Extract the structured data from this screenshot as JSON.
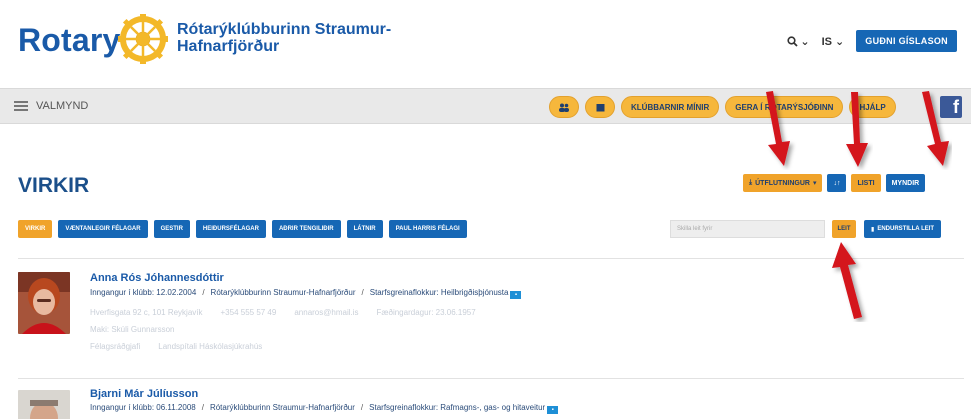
{
  "header": {
    "logo_word": "Rotary",
    "club_name_line1": "Rótarýklúbburinn Straumur-",
    "club_name_line2": "Hafnarfjörður",
    "search_label": "Q",
    "lang_label": "IS",
    "user_button": "GUÐNI GÍSLASON"
  },
  "menubar": {
    "menu_label": "VALMYND",
    "klubbarnir_label": "KLÚBBARNIR MÍNIR",
    "gerast_label": "GERA Í RÓTARÝSJÓÐINN",
    "help_label": "HJÁLP",
    "facebook_glyph": "f"
  },
  "page": {
    "title": "VIRKIR"
  },
  "view_controls": {
    "export_label": "ÚTFLUTNINGUR",
    "list_label": "LISTI",
    "images_label": "MYNDIR"
  },
  "filters": {
    "items": [
      "VIRKIR",
      "VÆNTANLEGIR FÉLAGAR",
      "GESTIR",
      "HEIÐURSFÉLAGAR",
      "AÐRIR TENGILIÐIR",
      "LÁTNIR",
      "PAUL HARRIS FÉLAGI"
    ],
    "search_placeholder": "Skilla leit fyrir",
    "search_button": "LEIT",
    "reset_button": "ENDURSTILLA LEIT"
  },
  "members": [
    {
      "name": "Anna Rós Jóhannesdóttir",
      "info_join": "Inngangur í klúbb: 12.02.2004",
      "info_club": "Rótarýklúbburinn Straumur-Hafnarfjörður",
      "info_category": "Starfsgreinaflokkur: Heilbrigðisþjónusta",
      "faded_address": "Hverfisgata 92 c, 101 Reykjavík",
      "faded_phone": "+354 555 57 49",
      "faded_email": "annaros@hmail.is",
      "faded_birthday": "Fæðingardagur: 23.06.1957",
      "faded_spouse": "Maki: Skúli Gunnarsson",
      "faded_workplace": "Félagsráðgjafi",
      "faded_employer": "Landspítali Háskólasjúkrahús"
    },
    {
      "name": "Bjarni Már Júlíusson",
      "info_join": "Inngangur í klúbb: 06.11.2008",
      "info_club": "Rótarýklúbburinn Straumur-Hafnarfjörður",
      "info_category": "Starfsgreinaflokkur: Rafmagns-, gas- og hitaveitur"
    }
  ],
  "colors": {
    "brand_blue": "#1667b5",
    "accent_orange": "#f0a32a",
    "arrow_red": "#d4121f"
  }
}
